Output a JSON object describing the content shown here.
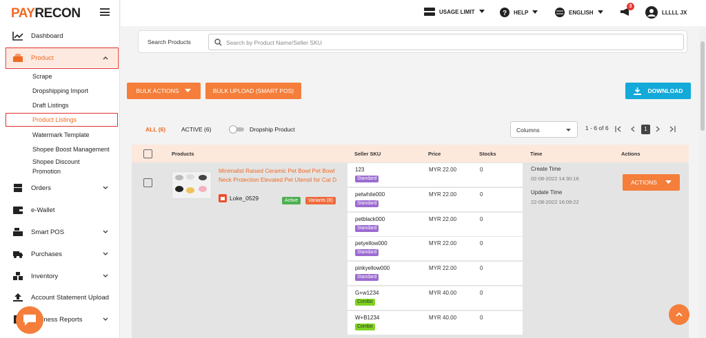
{
  "app": {
    "logo_a": "PAY",
    "logo_b": "RECON"
  },
  "sidebar": {
    "items": [
      {
        "label": "Dashboard",
        "icon": "chart-line-icon"
      },
      {
        "label": "Product",
        "icon": "box-icon"
      },
      {
        "label": "Orders",
        "icon": "box-stack-icon"
      },
      {
        "label": "e-Wallet",
        "icon": "wallet-icon"
      },
      {
        "label": "Smart POS",
        "icon": "cash-register-icon"
      },
      {
        "label": "Purchases",
        "icon": "truck-icon"
      },
      {
        "label": "Inventory",
        "icon": "boxes-icon"
      },
      {
        "label": "Account Statement Upload",
        "icon": "upload-icon"
      },
      {
        "label": "Business Reports",
        "icon": "report-icon"
      }
    ],
    "product_sub": [
      "Scrape",
      "Dropshipping Import",
      "Draft Listings",
      "Product Listings",
      "Watermark Template",
      "Shopee Boost Management",
      "Shopee Discount",
      "Promotion"
    ]
  },
  "topbar": {
    "usage": "USAGE LIMIT",
    "help": "HELP",
    "lang": "ENGLISH",
    "notif_count": "3",
    "user": "LLLLL JX"
  },
  "search": {
    "label": "Search Products",
    "placeholder": "Search by Product Name/Seller SKU"
  },
  "buttons": {
    "bulk_actions": "BULK ACTIONS",
    "bulk_upload": "BULK UPLOAD (SMART POS)",
    "download": "DOWNLOAD",
    "actions": "ACTIONS"
  },
  "tabs": {
    "all": "ALL (6)",
    "active": "ACTIVE (6)",
    "dropship": "Dropship Product"
  },
  "columns_select": "Columns",
  "pagination": {
    "range": "1 - 6 of 6",
    "page": "1"
  },
  "table": {
    "headers": [
      "Products",
      "Seller SKU",
      "Price",
      "Stocks",
      "Time",
      "Actions"
    ],
    "product": {
      "title_line1": "Minimalist Raised Ceramic Pet Bowl Pet Bowl",
      "title_line2": "Neck Protection Elevated Pet Utensil for Cat D",
      "shop": "Loke_0529",
      "status": "Active",
      "variants": "Variants (8)"
    },
    "time": {
      "create_label": "Create Time",
      "create": "02-08-2022 14:30:16",
      "update_label": "Update Time",
      "update": "22-08-2022 16:09:22"
    },
    "rows": [
      {
        "sku": "123",
        "tag": "Standard",
        "price": "MYR 22.00",
        "stock": "0"
      },
      {
        "sku": "petwhite000",
        "tag": "Standard",
        "price": "MYR 22.00",
        "stock": "0"
      },
      {
        "sku": "petblack000",
        "tag": "Standard",
        "price": "MYR 22.00",
        "stock": "0"
      },
      {
        "sku": "petyellow000",
        "tag": "Standard",
        "price": "MYR 22.00",
        "stock": "0"
      },
      {
        "sku": "pinkyellow000",
        "tag": "Standard",
        "price": "MYR 22.00",
        "stock": "0"
      },
      {
        "sku": "G+w1234",
        "tag": "Combo",
        "price": "MYR 40.00",
        "stock": "0"
      },
      {
        "sku": "W+B1234",
        "tag": "Combo",
        "price": "MYR 40.00",
        "stock": "0"
      }
    ]
  },
  "colors": {
    "accent": "#f47e3a",
    "brand": "#f06a23",
    "teal": "#13a9d8",
    "standard": "#9b6bd1",
    "combo": "#7ed321",
    "active": "#4caf50",
    "variants": "#ef6a3c"
  }
}
